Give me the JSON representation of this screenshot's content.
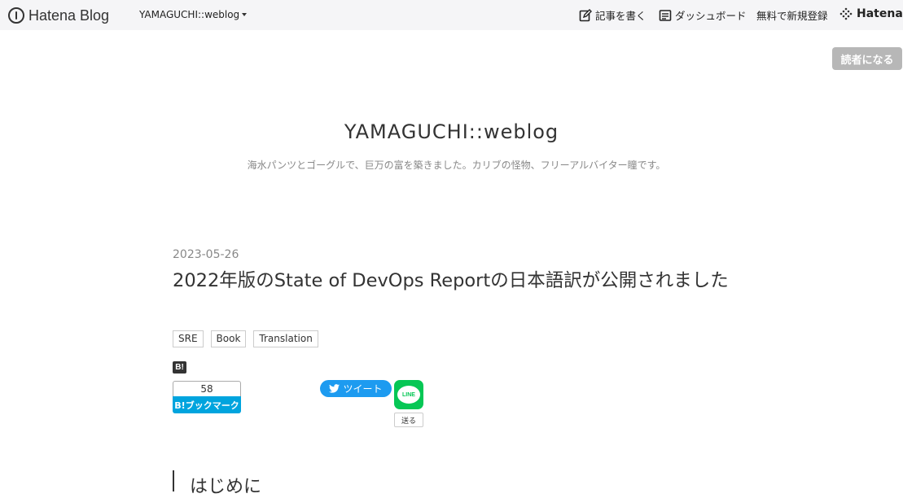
{
  "topbar": {
    "brand": "Hatena Blog",
    "blog_name": "YAMAGUCHI::weblog",
    "write_label": "記事を書く",
    "dashboard_label": "ダッシュボード",
    "signup_label": "無料で新規登録",
    "hatena_label": "Hatena"
  },
  "subscribe_label": "読者になる",
  "blog": {
    "title": "YAMAGUCHI::weblog",
    "description": "海水パンツとゴーグルで、巨万の富を築きました。カリブの怪物、フリーアルバイター瞳です。"
  },
  "entry": {
    "date": "2023-05-26",
    "title": "2022年版のState of DevOps Reportの日本語訳が公開されました",
    "tags": [
      "SRE",
      "Book",
      "Translation"
    ],
    "bookmark_count": "58",
    "bookmark_label": "B!ブックマーク",
    "bookmark_mini": "B!",
    "tweet_label": "ツイート",
    "line_label": "LINE",
    "line_send_label": "送る",
    "section_heading": "はじめに"
  },
  "colors": {
    "topbar_bg": "#f5f5f7",
    "bookmark_blue": "#00a4de",
    "twitter_blue": "#1d9bf0",
    "line_green": "#06c755",
    "subscribe_gray": "#b7b7b7"
  }
}
